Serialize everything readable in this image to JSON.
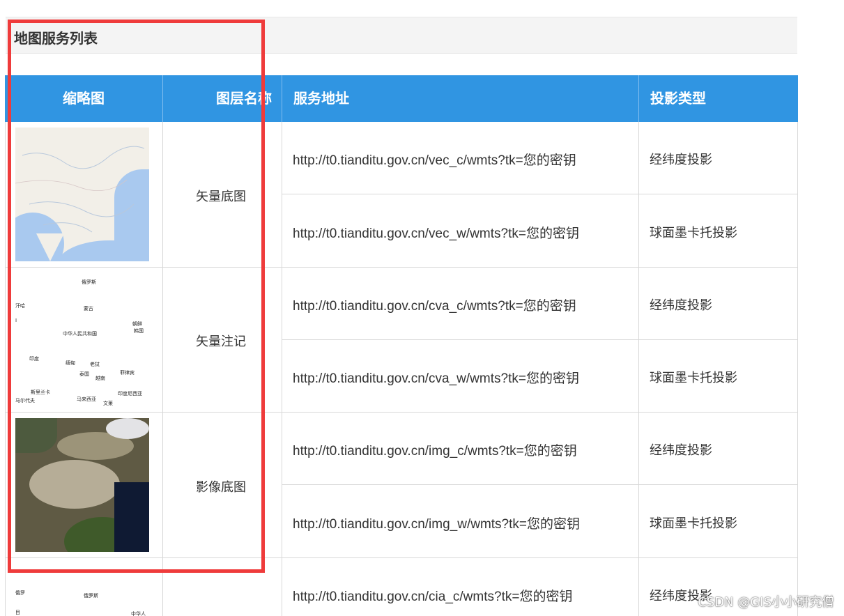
{
  "page_title": "地图服务列表",
  "table": {
    "headers": {
      "thumbnail": "缩略图",
      "layer_name": "图层名称",
      "service_url": "服务地址",
      "projection": "投影类型"
    },
    "groups": [
      {
        "layer_name": "矢量底图",
        "thumbnail": "vector-map-thumbnail",
        "rows": [
          {
            "url": "http://t0.tianditu.gov.cn/vec_c/wmts?tk=您的密钥",
            "projection": "经纬度投影"
          },
          {
            "url": "http://t0.tianditu.gov.cn/vec_w/wmts?tk=您的密钥",
            "projection": "球面墨卡托投影"
          }
        ]
      },
      {
        "layer_name": "矢量注记",
        "thumbnail": "annotation-map-thumbnail",
        "rows": [
          {
            "url": "http://t0.tianditu.gov.cn/cva_c/wmts?tk=您的密钥",
            "projection": "经纬度投影"
          },
          {
            "url": "http://t0.tianditu.gov.cn/cva_w/wmts?tk=您的密钥",
            "projection": "球面墨卡托投影"
          }
        ]
      },
      {
        "layer_name": "影像底图",
        "thumbnail": "imagery-map-thumbnail",
        "rows": [
          {
            "url": "http://t0.tianditu.gov.cn/img_c/wmts?tk=您的密钥",
            "projection": "经纬度投影"
          },
          {
            "url": "http://t0.tianditu.gov.cn/img_w/wmts?tk=您的密钥",
            "projection": "球面墨卡托投影"
          }
        ]
      },
      {
        "layer_name": "",
        "thumbnail": "image-annotation-thumbnail",
        "rows": [
          {
            "url": "http://t0.tianditu.gov.cn/cia_c/wmts?tk=您的密钥",
            "projection": "经纬度投影"
          }
        ]
      }
    ]
  },
  "annotation_labels": {
    "russia": "俄罗斯",
    "mongolia": "蒙古",
    "china": "中华人民共和国",
    "korea_n": "朝鲜",
    "korea_s": "韩国",
    "india": "印度",
    "myanmar": "缅甸",
    "laos": "老挝",
    "thailand": "泰国",
    "vietnam": "越南",
    "philippines": "菲律宾",
    "sri_lanka": "斯里兰卡",
    "maldives": "马尔代夫",
    "malaysia": "马来西亚",
    "brunei": "文莱",
    "indonesia": "印度尼西亚",
    "kz": "汗哈",
    "i": "I"
  },
  "bottom_labels": {
    "l1": "俄罗",
    "l2": "俄罗斯",
    "l3": "目",
    "l4": "中华人"
  },
  "watermark": "CSDN @GIS小小研究僧",
  "colors": {
    "header_bg": "#3095e2",
    "highlight": "#ef3b3b",
    "title_bar": "#f4f4f4"
  }
}
